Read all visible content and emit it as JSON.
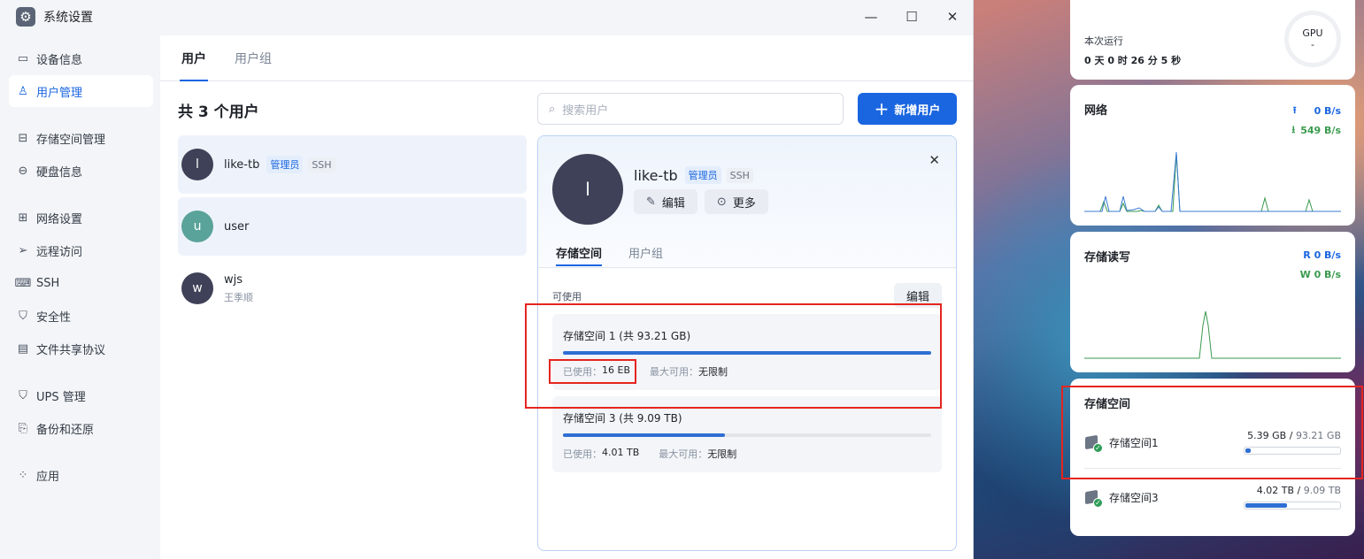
{
  "window": {
    "title": "系统设置",
    "icon": "gear-icon",
    "controls": [
      "minimize-icon",
      "maximize-icon",
      "close-icon"
    ]
  },
  "sidebar": {
    "items": [
      {
        "label": "设备信息",
        "icon": "device-icon"
      },
      {
        "label": "用户管理",
        "icon": "users-icon",
        "active": true
      },
      {
        "label": "存储空间管理",
        "icon": "storage-icon"
      },
      {
        "label": "硬盘信息",
        "icon": "disk-icon"
      },
      {
        "label": "网络设置",
        "icon": "network-icon"
      },
      {
        "label": "远程访问",
        "icon": "send-icon"
      },
      {
        "label": "SSH",
        "icon": "terminal-icon"
      },
      {
        "label": "安全性",
        "icon": "shield-icon"
      },
      {
        "label": "文件共享协议",
        "icon": "file-icon"
      },
      {
        "label": "UPS 管理",
        "icon": "shield-icon"
      },
      {
        "label": "备份和还原",
        "icon": "backup-icon"
      },
      {
        "label": "应用",
        "icon": "apps-icon"
      }
    ]
  },
  "tabs": [
    {
      "label": "用户",
      "active": true
    },
    {
      "label": "用户组",
      "active": false
    }
  ],
  "user_count": "共 3 个用户",
  "search": {
    "placeholder": "搜索用户"
  },
  "add_button": "新增用户",
  "users": [
    {
      "initial": "l",
      "name": "like-tb",
      "badges": [
        "管理员",
        "SSH"
      ],
      "sub": "",
      "color": "#3e4157"
    },
    {
      "initial": "u",
      "name": "user",
      "badges": [],
      "sub": "",
      "color": "#5aa39a"
    },
    {
      "initial": "w",
      "name": "wjs",
      "badges": [],
      "sub": "王季顺",
      "color": "#3e4157"
    }
  ],
  "detail": {
    "initial": "l",
    "name": "like-tb",
    "badge_admin": "管理员",
    "badge_ssh": "SSH",
    "edit_label": "编辑",
    "more_label": "更多",
    "tabs": [
      "存储空间",
      "用户组"
    ],
    "available_label": "可使用",
    "edit_button": "编辑",
    "storages": [
      {
        "title": "存储空间 1 (共 93.21 GB)",
        "used_label": "已使用：",
        "used": "16 EB",
        "max_label": "最大可用：",
        "max": "无限制",
        "fill": 1.0
      },
      {
        "title": "存储空间 3 (共 9.09 TB)",
        "used_label": "已使用：",
        "used": "4.01 TB",
        "max_label": "最大可用：",
        "max": "无限制",
        "fill": 0.44
      }
    ]
  },
  "widgets": {
    "runtime": {
      "label": "本次运行",
      "value": "0 天 0 时 26 分 5 秒",
      "gpu_label": "GPU",
      "gpu_value": "-"
    },
    "network": {
      "title": "网络",
      "up": "0 B/s",
      "down": "549 B/s",
      "up_color": "#1a66e0",
      "down_color": "#3a9a4e"
    },
    "disk_io": {
      "title": "存储读写",
      "r_label": "R",
      "r": "0 B/s",
      "w_label": "W",
      "w": "0 B/s"
    },
    "storage": {
      "title": "存储空间",
      "items": [
        {
          "name": "存储空间1",
          "used": "5.39 GB",
          "total": "93.21 GB",
          "fill": 0.06
        },
        {
          "name": "存储空间3",
          "used": "4.02 TB",
          "total": "9.09 TB",
          "fill": 0.44
        }
      ]
    }
  }
}
